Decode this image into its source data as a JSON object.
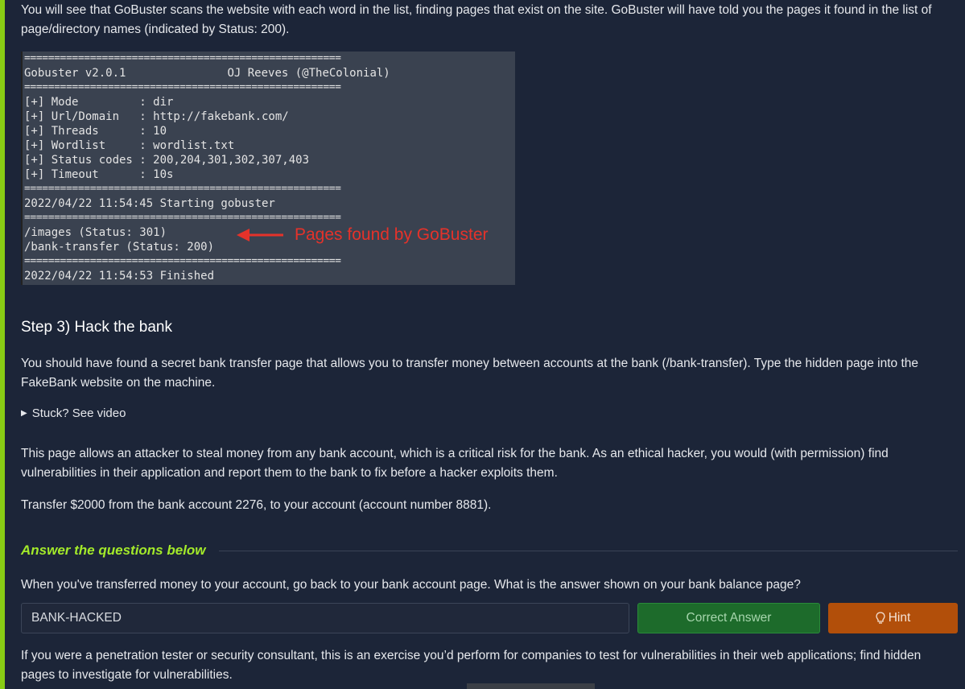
{
  "intro_text": "You will see that GoBuster scans the website with each word in the list, finding pages that exist on the site. GoBuster will have told you the pages it found in the list of page/directory names (indicated by Status: 200).",
  "terminal": {
    "separator": "=====================================================",
    "header_left": "Gobuster v2.0.1",
    "header_right": "OJ Reeves (@TheColonial)",
    "settings": [
      "[+] Mode         : dir",
      "[+] Url/Domain   : http://fakebank.com/",
      "[+] Threads      : 10",
      "[+] Wordlist     : wordlist.txt",
      "[+] Status codes : 200,204,301,302,307,403",
      "[+] Timeout      : 10s"
    ],
    "start_line": "2022/04/22 11:54:45 Starting gobuster",
    "results": [
      "/images (Status: 301)",
      "/bank-transfer (Status: 200)"
    ],
    "end_line": "2022/04/22 11:54:53 Finished",
    "annotation": "Pages found by GoBuster",
    "annotation_color": "#e5322a"
  },
  "step3": {
    "title": "Step 3) Hack the bank",
    "paragraph": "You should have found a secret bank transfer page that allows you to transfer money between accounts at the bank (/bank-transfer). Type the hidden page into the FakeBank website on the machine.",
    "details_label": "Stuck? See video",
    "attack_paragraph": "This page allows an attacker to steal money from any bank account, which is a critical risk for the bank. As an ethical hacker, you would (with permission) find vulnerabilities in their application and report them to the bank to fix before a hacker exploits them.",
    "transfer_paragraph": "Transfer $2000 from the bank account 2276, to your account (account number 8881)."
  },
  "answers": {
    "heading": "Answer the questions below",
    "heading_color": "#a3ea2a",
    "question": "When you've transferred money to your account, go back to your bank account page. What is the answer shown on your bank balance page?",
    "answer_value": "BANK-HACKED",
    "correct_label": "Correct Answer",
    "hint_label": "Hint",
    "correct_color": "#1d6b2b",
    "hint_color": "#b24f0a"
  },
  "pentest_text": "If you were a penetration tester or security consultant, this is an exercise you’d perform for companies to test for vulnerabilities in their web applications; find hidden pages to investigate for vulnerabilities.",
  "accent_color": "#88cc14",
  "icons": {
    "details_marker": "triangle-right-icon",
    "hint": "lightbulb-icon",
    "annotation": "arrow-left-icon"
  }
}
